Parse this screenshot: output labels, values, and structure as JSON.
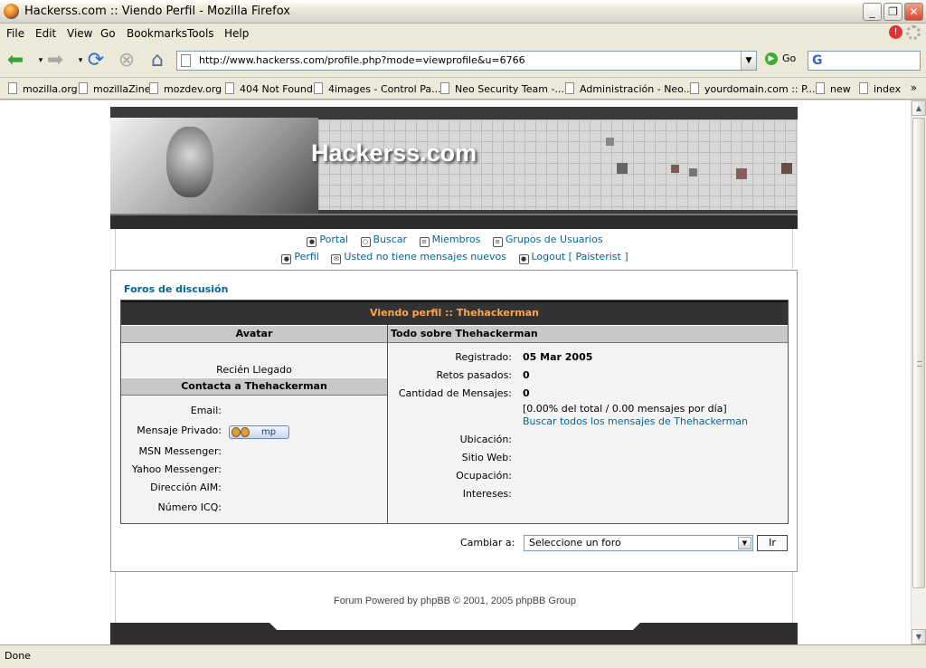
{
  "window": {
    "title": "Hackerss.com :: Viendo Perfil - Mozilla Firefox"
  },
  "menu": {
    "file": "File",
    "edit": "Edit",
    "view": "View",
    "go": "Go",
    "bookmarks": "Bookmarks",
    "tools": "Tools",
    "help": "Help"
  },
  "navbar": {
    "url": "http://www.hackerss.com/profile.php?mode=viewprofile&u=6766",
    "go_label": "Go",
    "search_logo": "G"
  },
  "bookmarks": [
    "mozilla.org",
    "mozillaZine",
    "mozdev.org",
    "404 Not Found",
    "4images - Control Pa...",
    "Neo Security Team -...",
    "Administración - Neo...",
    "yourdomain.com :: P...",
    "new",
    "index"
  ],
  "status": {
    "text": "Done"
  },
  "site": {
    "banner_title": "Hackerss.com",
    "nav_row1": [
      "Portal",
      "Buscar",
      "Miembros",
      "Grupos de Usuarios"
    ],
    "nav_row2": [
      "Perfil",
      "Usted no tiene mensajes nuevos",
      "Logout [ Paisterist ]"
    ],
    "forum_link": "Foros de discusión",
    "profile_header": "Viendo perfil :: Thehackerman",
    "avatar_header": "Avatar",
    "about_header": "Todo sobre Thehackerman",
    "rank": "Recién Llegado",
    "contact_header": "Contacta a Thehackerman",
    "contact_labels": {
      "email": "Email:",
      "pm": "Mensaje Privado:",
      "msn": "MSN Messenger:",
      "yahoo": "Yahoo Messenger:",
      "aim": "Dirección AIM:",
      "icq": "Número ICQ:"
    },
    "pm_button": "mp",
    "about_labels": {
      "registered": "Registrado:",
      "challenges": "Retos pasados:",
      "posts": "Cantidad de Mensajes:",
      "location": "Ubicación:",
      "website": "Sitio Web:",
      "occupation": "Ocupación:",
      "interests": "Intereses:"
    },
    "about_values": {
      "registered": "05 Mar 2005",
      "challenges": "0",
      "posts": "0",
      "posts_stats": "[0.00% del total / 0.00 mensajes por día]",
      "search_posts": "Buscar todos los mensajes de Thehackerman"
    },
    "jump_label": "Cambiar a:",
    "jump_select": "Seleccione un foro",
    "jump_button": "Ir",
    "footer": "Forum Powered by phpBB © 2001, 2005 phpBB Group"
  }
}
